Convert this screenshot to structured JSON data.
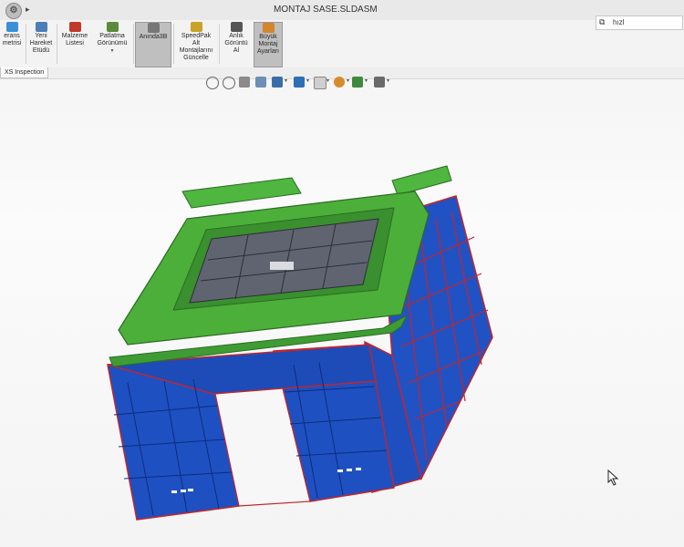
{
  "window": {
    "title": "MONTAJ SASE.SLDASM",
    "search_value": "hızl",
    "search_icon": "command-search-icon"
  },
  "ribbon": {
    "buttons": [
      {
        "key": "b0",
        "label": "erans\nmetrisi",
        "icon": "tolerance-icon",
        "color": "#3a8fd6"
      },
      {
        "key": "b1",
        "label": "Yeni\nHareket\nEtüdü",
        "icon": "motion-study-icon",
        "color": "#4a7fb8"
      },
      {
        "key": "b2",
        "label": "Malzeme\nListesi",
        "icon": "bom-icon",
        "color": "#c0392b"
      },
      {
        "key": "b3",
        "label": "Patlatma\nGörünümü",
        "icon": "exploded-view-icon",
        "color": "#5a8a3a"
      },
      {
        "key": "b4",
        "label": "Anında3B",
        "icon": "instant3d-icon",
        "color": "#777777"
      },
      {
        "key": "b5",
        "label": "SpeedPak\nAlt\nMontajlarını\nGüncelle",
        "icon": "speedpak-icon",
        "color": "#c9a227"
      },
      {
        "key": "b6",
        "label": "Anlık\nGörüntü\nAl",
        "icon": "snapshot-icon",
        "color": "#555555"
      },
      {
        "key": "b7",
        "label": "Büyük\nMontaj\nAyarları",
        "icon": "large-assembly-icon",
        "color": "#d4862a"
      }
    ],
    "active_tab": "XS Inspection"
  },
  "view_toolbar": {
    "icons": [
      "zoom-to-fit-icon",
      "zoom-area-icon",
      "previous-view-icon",
      "section-view-icon",
      "view-orientation-icon",
      "display-style-icon",
      "hide-show-items-icon",
      "edit-appearance-icon",
      "apply-scene-icon",
      "view-settings-icon"
    ]
  },
  "model": {
    "frame_color": "#1f4fbf",
    "cover_color": "#4caf3a",
    "edge_color": "#c0262d",
    "grille_color": "#5f6470"
  }
}
